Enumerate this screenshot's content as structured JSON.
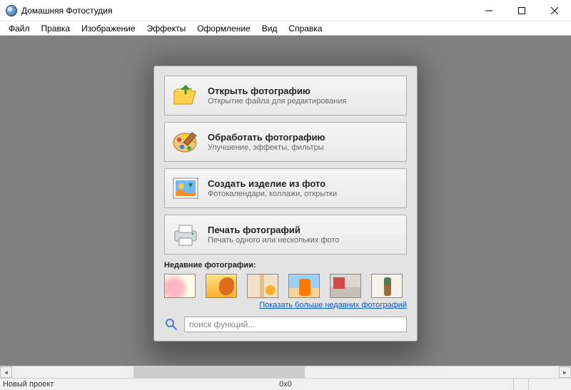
{
  "window": {
    "title": "Домашняя Фотостудия"
  },
  "menu": [
    "Файл",
    "Правка",
    "Изображение",
    "Эффекты",
    "Оформление",
    "Вид",
    "Справка"
  ],
  "actions": {
    "open": {
      "title": "Открыть фотографию",
      "sub": "Открытие файла для редактирования"
    },
    "process": {
      "title": "Обработать фотографию",
      "sub": "Улучшение, эффекты, фильтры"
    },
    "create": {
      "title": "Создать изделие из фото",
      "sub": "Фотокалендари, коллажи, открытки"
    },
    "print": {
      "title": "Печать фотографий",
      "sub": "Печать одного или нескольких фото"
    }
  },
  "recent": {
    "label": "Недавние фотографии:",
    "more": "Показать больше недавних фотографий"
  },
  "search": {
    "placeholder": "поиск функций..."
  },
  "status": {
    "project": "Новый проект",
    "dims": "0x0"
  }
}
